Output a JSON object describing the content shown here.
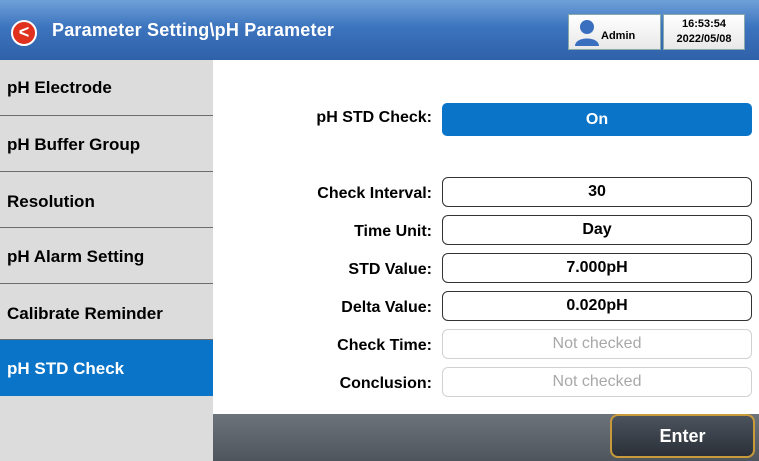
{
  "header": {
    "back_icon": "chevron-left-icon",
    "title": "Parameter Setting\\pH Parameter",
    "user": "Admin",
    "time": "16:53:54",
    "date": "2022/05/08"
  },
  "sidebar": {
    "items": [
      {
        "label": "pH Electrode"
      },
      {
        "label": "pH Buffer Group"
      },
      {
        "label": "Resolution"
      },
      {
        "label": "pH Alarm Setting"
      },
      {
        "label": "Calibrate Reminder"
      },
      {
        "label": "pH STD Check",
        "active": true
      }
    ]
  },
  "form": {
    "std_check": {
      "label": "pH STD Check:",
      "value": "On"
    },
    "check_interval": {
      "label": "Check Interval:",
      "value": "30"
    },
    "time_unit": {
      "label": "Time Unit:",
      "value": "Day"
    },
    "std_value": {
      "label": "STD Value:",
      "value": "7.000pH"
    },
    "delta_value": {
      "label": "Delta Value:",
      "value": "0.020pH"
    },
    "check_time": {
      "label": "Check Time:",
      "value": "Not checked"
    },
    "conclusion": {
      "label": "Conclusion:",
      "value": "Not checked"
    }
  },
  "footer": {
    "enter_label": "Enter"
  },
  "colors": {
    "accent": "#0a74c8",
    "back_button": "#e0301e",
    "header": "#3c74be"
  }
}
